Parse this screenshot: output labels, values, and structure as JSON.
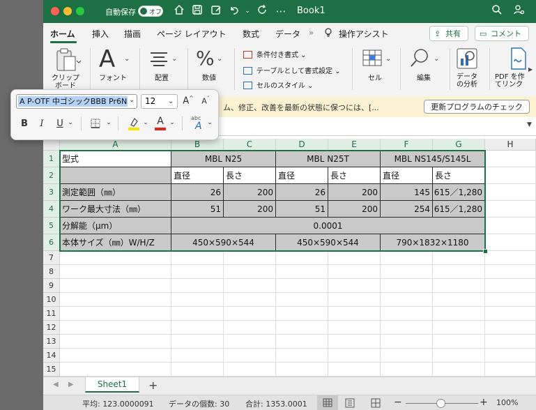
{
  "titlebar": {
    "autosave_label": "自動保存",
    "autosave_state": "オフ",
    "title": "Book1"
  },
  "tabs": [
    "ホーム",
    "挿入",
    "描画",
    "ページ レイアウト",
    "数式",
    "データ",
    "操作アシスト"
  ],
  "tab_actions": {
    "share": "共有",
    "comment": "コメント"
  },
  "ribbon": {
    "clipboard": "クリップ\nボード",
    "font": "フォント",
    "alignment": "配置",
    "number": "数値",
    "styles": [
      "条件付き書式",
      "テーブルとして書式設定",
      "セルのスタイル"
    ],
    "cells": "セル",
    "edit": "編集",
    "analyze": "データ\nの分析",
    "pdf": "PDF を作\nてリンク"
  },
  "update_bar": {
    "message": "ム、修正、改善を最新の状態に保つには、[...",
    "button": "更新プログラムのチェック"
  },
  "floating_toolbar": {
    "font_name": "A P-OTF 中ゴシックBBB Pr6N",
    "font_size": "12",
    "grow_icon": "A^",
    "shrink_icon": "A˅",
    "bold": "B",
    "italic": "I",
    "underline": "U",
    "highlight_color": "#f2e600",
    "font_color": "#e0261b"
  },
  "grid": {
    "columns": [
      "A",
      "B",
      "C",
      "D",
      "E",
      "F",
      "G",
      "H"
    ],
    "rows": [
      "1",
      "2",
      "3",
      "4",
      "5",
      "6",
      "7",
      "8",
      "9",
      "10",
      "11",
      "12",
      "13",
      "14",
      "15"
    ],
    "cells": {
      "A1": "型式",
      "B1": "MBL N25",
      "D1": "MBL N25T",
      "F1": "MBL NS145/S145L",
      "B2": "直径",
      "C2": "長さ",
      "D2": "直径",
      "E2": "長さ",
      "F2": "直径",
      "G2": "長さ",
      "A3": "測定範囲（㎜）",
      "B3": "26",
      "C3": "200",
      "D3": "26",
      "E3": "200",
      "F3": "145",
      "G3": "615／1,280",
      "A4": "ワーク最大寸法（㎜）",
      "B4": "51",
      "C4": "200",
      "D4": "51",
      "E4": "200",
      "F4": "254",
      "G4": "615／1,280",
      "A5": "分解能（μm）",
      "B5": "0.0001",
      "A6": "本体サイズ（㎜）W/H/Z",
      "B6": "450×590×544",
      "D6": "450×590×544",
      "F6": "790×1832×1180"
    }
  },
  "sheets": [
    "Sheet1"
  ],
  "statusbar": {
    "average": "平均: 123.0000091",
    "count": "データの個数: 30",
    "sum": "合計: 1353.0001",
    "zoom": "100%"
  }
}
